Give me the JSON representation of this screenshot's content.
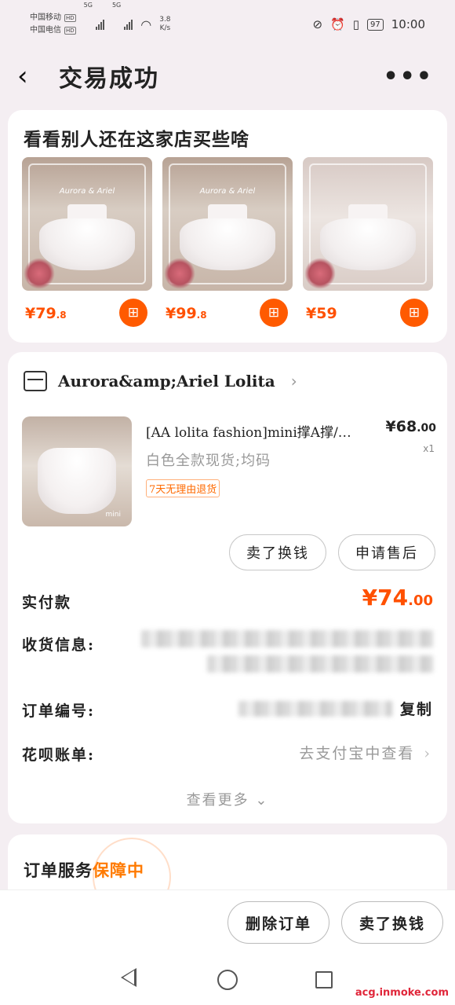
{
  "status_bar": {
    "carrier1": "中国移动",
    "carrier2": "中国电信",
    "hd": "HD",
    "net1": "5G",
    "net2": "5G",
    "speed_value": "3.8",
    "speed_unit": "K/s",
    "battery": "97",
    "time": "10:00"
  },
  "nav": {
    "back_icon": "chevron-left",
    "title": "交易成功",
    "more_icon": "more-dots"
  },
  "recommend": {
    "title": "看看别人还在这家店买些啥",
    "items": [
      {
        "price_main": "¥79",
        "price_dec": ".8",
        "img_text": "Aurora & Ariel"
      },
      {
        "price_main": "¥99",
        "price_dec": ".8",
        "img_text": "Aurora & Ariel"
      },
      {
        "price_main": "¥59",
        "price_dec": "",
        "img_text": ""
      }
    ]
  },
  "order": {
    "shop_name": "Aurora&amp;Ariel Lolita",
    "product_title": "[AA lolita fashion]mini撑A撑/…",
    "price_main": "¥68",
    "price_dec": ".00",
    "qty": "x1",
    "spec": "白色全款现货;均码",
    "tag": "7天无理由退货",
    "img_text": "mini",
    "btn_sell": "卖了换钱",
    "btn_after": "申请售后",
    "paid_label": "实付款",
    "paid_main": "¥74",
    "paid_dec": ".00",
    "address_label": "收货信息:",
    "order_no_label": "订单编号:",
    "copy": "复制",
    "huabei_label": "花呗账单:",
    "huabei_link": "去支付宝中查看",
    "view_more": "查看更多"
  },
  "service": {
    "title": "订单服务",
    "guard": "保障中"
  },
  "bottom": {
    "delete": "删除订单",
    "sell": "卖了换钱"
  },
  "watermark": "acg.inmoke.com"
}
